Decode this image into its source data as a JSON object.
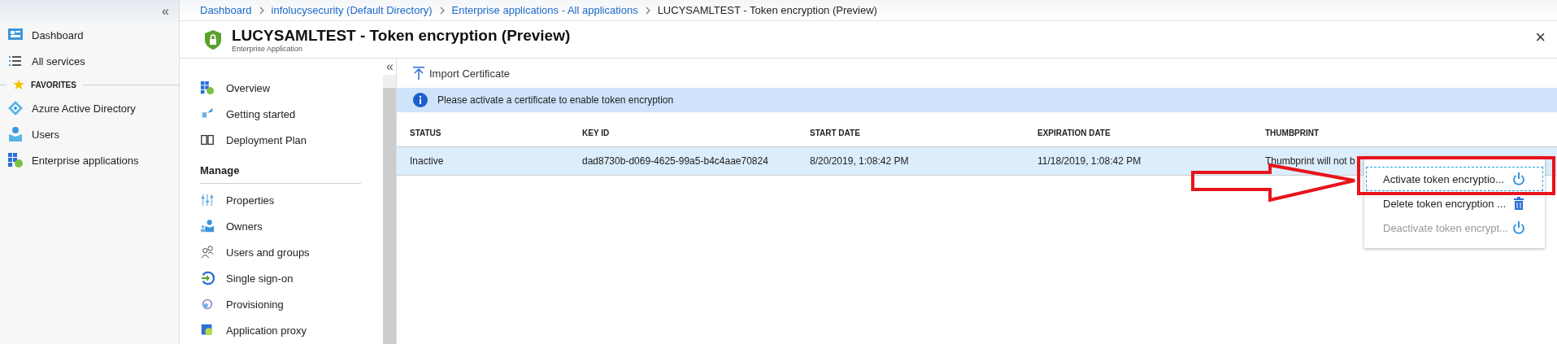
{
  "sidebar": {
    "collapse": "«",
    "items": [
      {
        "label": "Dashboard"
      },
      {
        "label": "All services"
      }
    ],
    "favorites_header": "FAVORITES",
    "favorites": [
      {
        "label": "Azure Active Directory"
      },
      {
        "label": "Users"
      },
      {
        "label": "Enterprise applications"
      }
    ]
  },
  "breadcrumb": [
    {
      "label": "Dashboard",
      "kind": "link"
    },
    {
      "label": "infolucysecurity (Default Directory)",
      "kind": "link"
    },
    {
      "label": "Enterprise applications - All applications",
      "kind": "link"
    },
    {
      "label": "LUCYSAMLTEST - Token encryption (Preview)",
      "kind": "current"
    }
  ],
  "blade": {
    "title": "LUCYSAMLTEST - Token encryption (Preview)",
    "subtitle": "Enterprise Application",
    "close": "×"
  },
  "blade_nav": {
    "collapse": "«",
    "items": [
      {
        "label": "Overview"
      },
      {
        "label": "Getting started"
      },
      {
        "label": "Deployment Plan"
      }
    ],
    "section": "Manage",
    "section_items": [
      {
        "label": "Properties"
      },
      {
        "label": "Owners"
      },
      {
        "label": "Users and groups"
      },
      {
        "label": "Single sign-on"
      },
      {
        "label": "Provisioning"
      },
      {
        "label": "Application proxy"
      }
    ]
  },
  "toolbar": {
    "import": "Import Certificate"
  },
  "info_bar": "Please activate a certificate to enable token encryption",
  "table": {
    "columns": [
      "STATUS",
      "KEY ID",
      "START DATE",
      "EXPIRATION DATE",
      "THUMBPRINT"
    ],
    "rows": [
      {
        "selected": true,
        "cells": [
          "Inactive",
          "dad8730b-d069-4625-99a5-b4c4aae70824",
          "8/20/2019, 1:08:42 PM",
          "11/18/2019, 1:08:42 PM",
          "Thumbprint will not b"
        ]
      }
    ]
  },
  "context_menu": [
    {
      "label": "Activate token encryptio...",
      "kind": "power",
      "focused": true,
      "disabled": false
    },
    {
      "label": "Delete token encryption ...",
      "kind": "delete",
      "focused": false,
      "disabled": false
    },
    {
      "label": "Deactivate token encrypt...",
      "kind": "power",
      "focused": false,
      "disabled": true
    }
  ]
}
